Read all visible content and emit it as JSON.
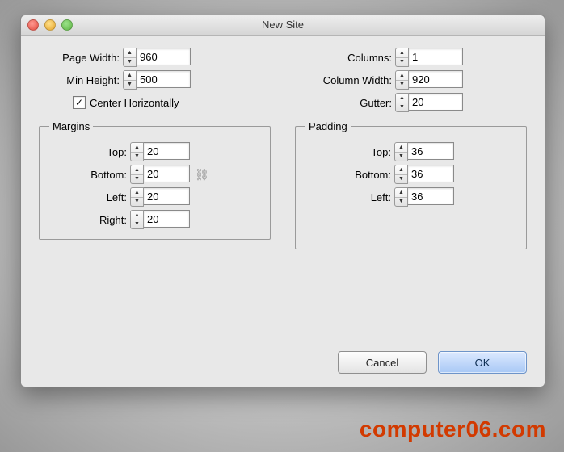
{
  "window": {
    "title": "New Site"
  },
  "page": {
    "width_label": "Page Width:",
    "width_value": "960",
    "min_height_label": "Min Height:",
    "min_height_value": "500",
    "center_label": "Center Horizontally",
    "center_checked": "✓"
  },
  "columns": {
    "columns_label": "Columns:",
    "columns_value": "1",
    "col_width_label": "Column Width:",
    "col_width_value": "920",
    "gutter_label": "Gutter:",
    "gutter_value": "20"
  },
  "margins": {
    "legend": "Margins",
    "top_label": "Top:",
    "top_value": "20",
    "bottom_label": "Bottom:",
    "bottom_value": "20",
    "left_label": "Left:",
    "left_value": "20",
    "right_label": "Right:",
    "right_value": "20"
  },
  "padding": {
    "legend": "Padding",
    "top_label": "Top:",
    "top_value": "36",
    "bottom_label": "Bottom:",
    "bottom_value": "36",
    "left_label": "Left:",
    "left_value": "36"
  },
  "buttons": {
    "cancel": "Cancel",
    "ok": "OK"
  },
  "watermark": "computer06.com"
}
